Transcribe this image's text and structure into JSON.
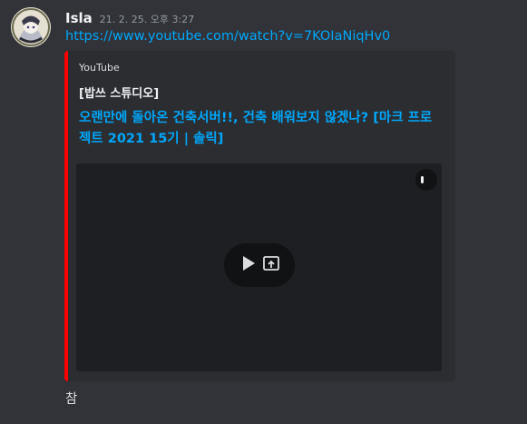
{
  "message": {
    "username": "Isla",
    "timestamp": "21. 2. 25. 오후 3:27",
    "link_text": "https://www.youtube.com/watch?v=7KOIaNiqHv0",
    "embed": {
      "accent_color": "#ff0000",
      "provider": "YouTube",
      "author": "[밥쓰 스튜디오]",
      "title": "오랜만에 돌아온 건축서버!!, 건축 배워보지 않겠나? [마크 프로젝트 2021 15기 | 솔릭]",
      "icons": [
        "play-icon",
        "popout-icon"
      ]
    }
  },
  "next_message": {
    "text": "참"
  }
}
